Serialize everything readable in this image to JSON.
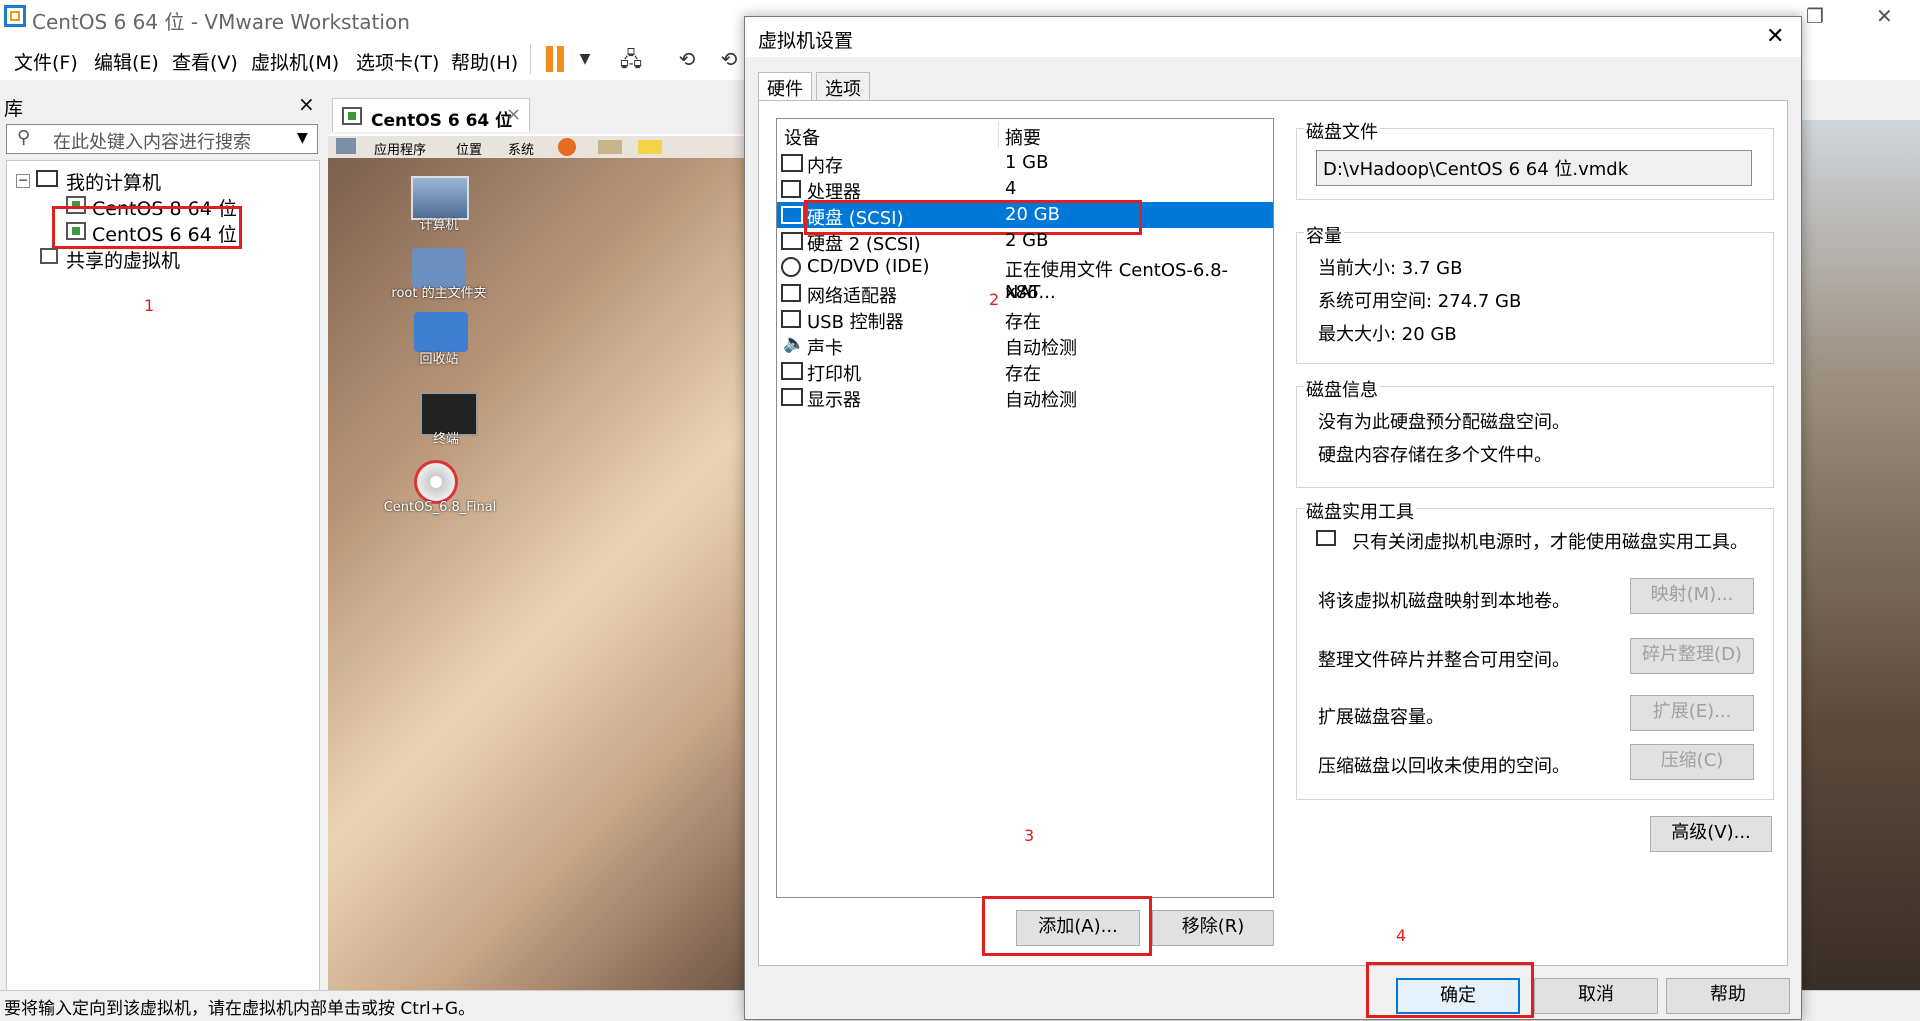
{
  "window": {
    "title": "CentOS 6 64 位 - VMware Workstation"
  },
  "menu": [
    "文件(F)",
    "编辑(E)",
    "查看(V)",
    "虚拟机(M)",
    "选项卡(T)",
    "帮助(H)"
  ],
  "library": {
    "title": "库",
    "close": "×",
    "search_placeholder": "在此处键入内容进行搜索",
    "tree": {
      "root": "我的计算机",
      "vms": [
        "CentOS 8 64 位",
        "CentOS 6 64 位"
      ],
      "shared": "共享的虚拟机"
    }
  },
  "vm_tab": {
    "label": "CentOS 6 64 位",
    "close": "×"
  },
  "guest": {
    "menu": [
      "应用程序",
      "位置",
      "系统"
    ],
    "desktop_icons": [
      "计算机",
      "root 的主文件夹",
      "回收站",
      "终端",
      "CentOS_6.8_Final"
    ]
  },
  "status_bar": {
    "text": "要将输入定向到该虚拟机，请在虚拟机内部单击或按 Ctrl+G。"
  },
  "annotations": [
    "1",
    "2",
    "3",
    "4"
  ],
  "dialog": {
    "title": "虚拟机设置",
    "close": "✕",
    "tabs": [
      "硬件",
      "选项"
    ],
    "columns": [
      "设备",
      "摘要"
    ],
    "devices": [
      {
        "name": "内存",
        "summary": "1 GB"
      },
      {
        "name": "处理器",
        "summary": "4"
      },
      {
        "name": "硬盘 (SCSI)",
        "summary": "20 GB"
      },
      {
        "name": "硬盘 2 (SCSI)",
        "summary": "2 GB"
      },
      {
        "name": "CD/DVD (IDE)",
        "summary": "正在使用文件 CentOS-6.8-x86..."
      },
      {
        "name": "网络适配器",
        "summary": "NAT"
      },
      {
        "name": "USB 控制器",
        "summary": "存在"
      },
      {
        "name": "声卡",
        "summary": "自动检测"
      },
      {
        "name": "打印机",
        "summary": "存在"
      },
      {
        "name": "显示器",
        "summary": "自动检测"
      }
    ],
    "selected_index": 2,
    "add_button": "添加(A)...",
    "remove_button": "移除(R)",
    "disk_file": {
      "label": "磁盘文件",
      "value": "D:\\vHadoop\\CentOS 6 64 位.vmdk"
    },
    "capacity": {
      "label": "容量",
      "current": "当前大小: 3.7 GB",
      "available": "系统可用空间: 274.7 GB",
      "max": "最大大小: 20 GB"
    },
    "disk_info": {
      "label": "磁盘信息",
      "line1": "没有为此硬盘预分配磁盘空间。",
      "line2": "硬盘内容存储在多个文件中。"
    },
    "utilities": {
      "label": "磁盘实用工具",
      "note": "只有关闭虚拟机电源时，才能使用磁盘实用工具。",
      "map_text": "将该虚拟机磁盘映射到本地卷。",
      "map_btn": "映射(M)...",
      "defrag_text": "整理文件碎片并整合可用空间。",
      "defrag_btn": "碎片整理(D)",
      "expand_text": "扩展磁盘容量。",
      "expand_btn": "扩展(E)...",
      "compact_text": "压缩磁盘以回收未使用的空间。",
      "compact_btn": "压缩(C)"
    },
    "advanced_btn": "高级(V)...",
    "ok_btn": "确定",
    "cancel_btn": "取消",
    "help_btn": "帮助"
  },
  "colors": {
    "selection": "#0078d7",
    "annotation": "#e02020"
  }
}
